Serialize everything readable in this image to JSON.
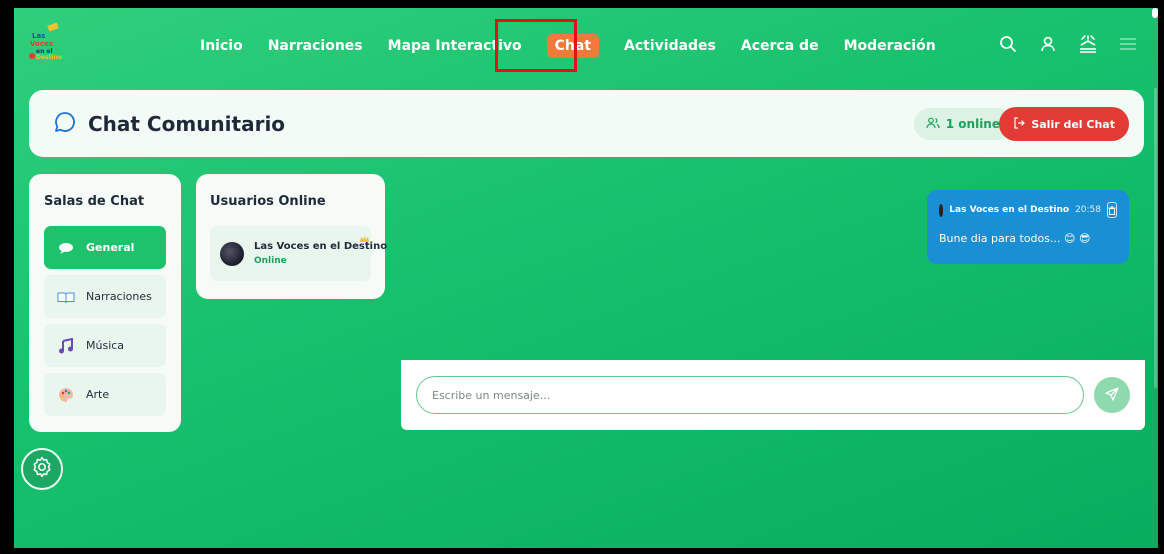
{
  "nav": {
    "logo_text": "Las Voces en el Destino",
    "links": [
      "Inicio",
      "Narraciones",
      "Mapa Interactivo",
      "Chat",
      "Actividades",
      "Acerca de",
      "Moderación"
    ],
    "active": "Chat"
  },
  "header": {
    "title": "Chat Comunitario",
    "online_count": "1 online",
    "leave_label": "Salir del Chat"
  },
  "rooms": {
    "title": "Salas de Chat",
    "items": [
      {
        "label": "General",
        "icon": "speech-bubble-icon",
        "active": true
      },
      {
        "label": "Narraciones",
        "icon": "open-book-icon",
        "active": false
      },
      {
        "label": "Música",
        "icon": "music-note-icon",
        "active": false
      },
      {
        "label": "Arte",
        "icon": "palette-icon",
        "active": false
      }
    ]
  },
  "users": {
    "title": "Usuarios Online",
    "items": [
      {
        "name": "Las Voces en el Destino",
        "status": "Online"
      }
    ]
  },
  "messages": [
    {
      "author": "Las Voces en el Destino",
      "time": "20:58",
      "text": "Bune dia para todos... 😊 😎"
    }
  ],
  "composer": {
    "placeholder": "Escribe un mensaje..."
  },
  "colors": {
    "background": "#16c06d",
    "active_tab": "#f07a3a",
    "leave_button": "#e23a35",
    "message_bubble": "#1a8fd3",
    "highlight": "#e3101a"
  }
}
